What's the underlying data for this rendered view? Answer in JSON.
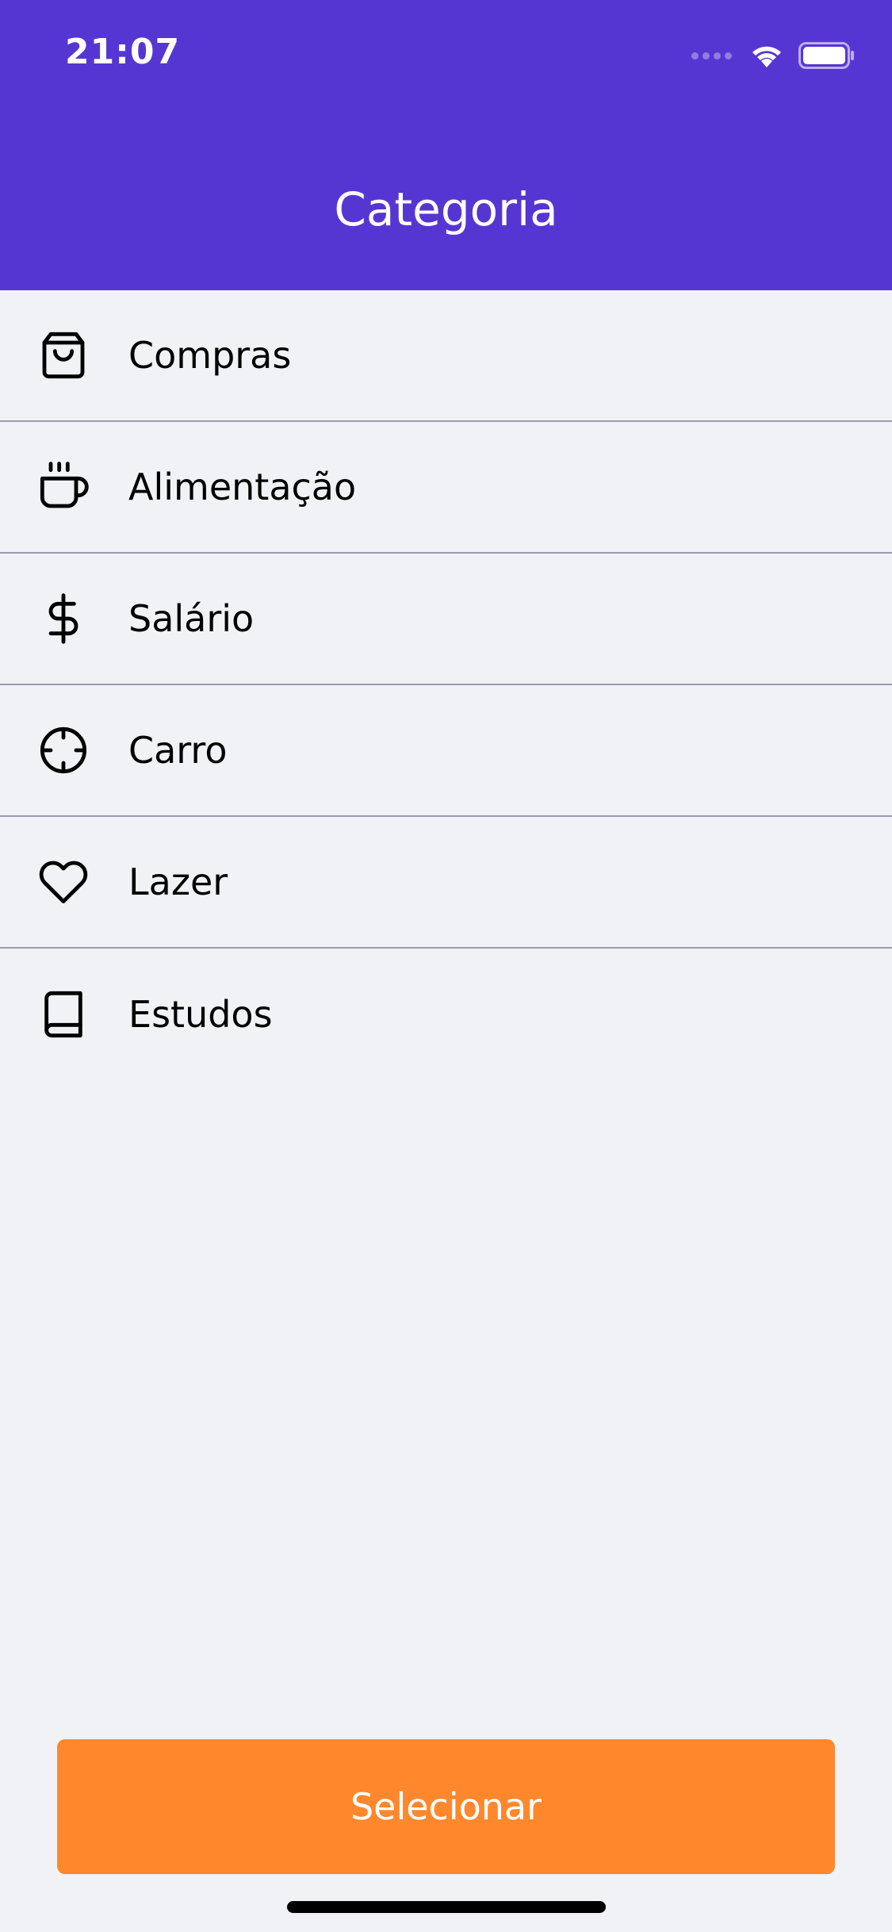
{
  "status_bar": {
    "time": "21:07"
  },
  "header": {
    "title": "Categoria",
    "background_color": "#5636D3"
  },
  "categories": [
    {
      "label": "Compras",
      "icon": "shopping-bag-icon"
    },
    {
      "label": "Alimentação",
      "icon": "coffee-icon"
    },
    {
      "label": "Salário",
      "icon": "dollar-sign-icon"
    },
    {
      "label": "Carro",
      "icon": "crosshair-icon"
    },
    {
      "label": "Lazer",
      "icon": "heart-icon"
    },
    {
      "label": "Estudos",
      "icon": "book-icon"
    }
  ],
  "footer": {
    "select_label": "Selecionar",
    "button_color": "#FF872C"
  }
}
